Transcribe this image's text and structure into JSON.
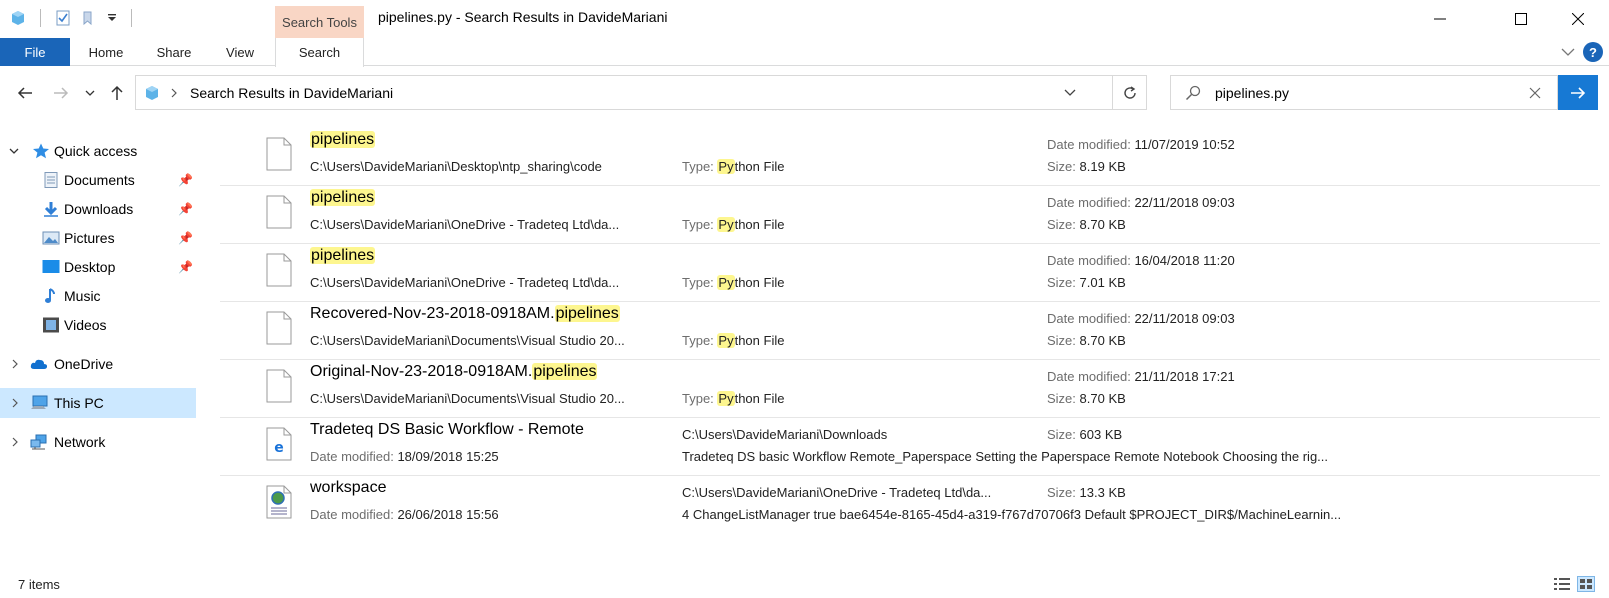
{
  "window": {
    "title": "pipelines.py - Search Results in DavideMariani",
    "context_tab_group": "Search Tools"
  },
  "ribbon": {
    "tabs": [
      "File",
      "Home",
      "Share",
      "View",
      "Search"
    ]
  },
  "address_bar": {
    "path": "Search Results in DavideMariani"
  },
  "search": {
    "value": "pipelines.py"
  },
  "nav_pane": {
    "quick_access": "Quick access",
    "pinned": [
      "Documents",
      "Downloads",
      "Pictures",
      "Desktop"
    ],
    "unpinned": [
      "Music",
      "Videos"
    ],
    "onedrive": "OneDrive",
    "this_pc": "This PC",
    "network": "Network"
  },
  "labels": {
    "date_modified": "Date modified:",
    "size": "Size:",
    "type": "Type:",
    "type_hl": "Py",
    "type_rest": "thon File"
  },
  "results": [
    {
      "prefix": "",
      "match": "pipelines",
      "path": "C:\\Users\\DavideMariani\\Desktop\\ntp_sharing\\code",
      "date": "11/07/2019 10:52",
      "size": "8.19 KB"
    },
    {
      "prefix": "",
      "match": "pipelines",
      "path": "C:\\Users\\DavideMariani\\OneDrive - Tradeteq Ltd\\da...",
      "date": "22/11/2018 09:03",
      "size": "8.70 KB"
    },
    {
      "prefix": "",
      "match": "pipelines",
      "path": "C:\\Users\\DavideMariani\\OneDrive - Tradeteq Ltd\\da...",
      "date": "16/04/2018 11:20",
      "size": "7.01 KB"
    },
    {
      "prefix": "Recovered-Nov-23-2018-0918AM.",
      "match": "pipelines",
      "path": "C:\\Users\\DavideMariani\\Documents\\Visual Studio 20...",
      "date": "22/11/2018 09:03",
      "size": "8.70 KB"
    },
    {
      "prefix": "Original-Nov-23-2018-0918AM.",
      "match": "pipelines",
      "path": "C:\\Users\\DavideMariani\\Documents\\Visual Studio 20...",
      "date": "21/11/2018 17:21",
      "size": "8.70 KB"
    }
  ],
  "other_results": [
    {
      "name": "Tradeteq DS Basic Workflow - Remote",
      "date": "18/09/2018 15:25",
      "location": "C:\\Users\\DavideMariani\\Downloads",
      "size": "603 KB",
      "snippet": "Tradeteq DS basic Workflow Remote_Paperspace Setting the Paperspace Remote Notebook Choosing the rig..."
    },
    {
      "name": "workspace",
      "date": "26/06/2018 15:56",
      "location": "C:\\Users\\DavideMariani\\OneDrive - Tradeteq Ltd\\da...",
      "size": "13.3 KB",
      "snippet": "4 ChangeListManager true bae6454e-8165-45d4-a319-f767d70706f3 Default $PROJECT_DIR$/MachineLearnin..."
    }
  ],
  "status_bar": {
    "item_count": "7 items"
  },
  "colors": {
    "accent": "#1a65b8",
    "search_tools": "#f9d6c5",
    "highlight": "#fdf68f",
    "selection": "#cce8ff"
  }
}
